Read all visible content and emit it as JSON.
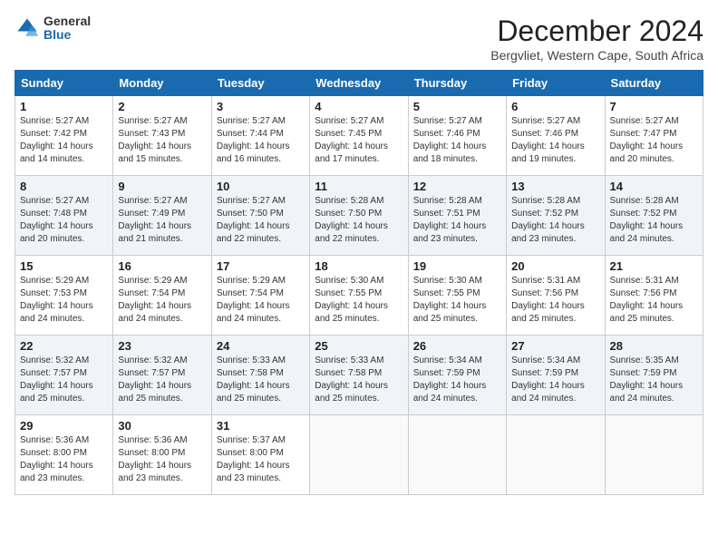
{
  "logo": {
    "general": "General",
    "blue": "Blue"
  },
  "title": "December 2024",
  "location": "Bergvliet, Western Cape, South Africa",
  "header_color": "#1a6ab0",
  "days_of_week": [
    "Sunday",
    "Monday",
    "Tuesday",
    "Wednesday",
    "Thursday",
    "Friday",
    "Saturday"
  ],
  "weeks": [
    [
      {
        "day": "1",
        "sunrise": "5:27 AM",
        "sunset": "7:42 PM",
        "daylight": "14 hours and 14 minutes."
      },
      {
        "day": "2",
        "sunrise": "5:27 AM",
        "sunset": "7:43 PM",
        "daylight": "14 hours and 15 minutes."
      },
      {
        "day": "3",
        "sunrise": "5:27 AM",
        "sunset": "7:44 PM",
        "daylight": "14 hours and 16 minutes."
      },
      {
        "day": "4",
        "sunrise": "5:27 AM",
        "sunset": "7:45 PM",
        "daylight": "14 hours and 17 minutes."
      },
      {
        "day": "5",
        "sunrise": "5:27 AM",
        "sunset": "7:46 PM",
        "daylight": "14 hours and 18 minutes."
      },
      {
        "day": "6",
        "sunrise": "5:27 AM",
        "sunset": "7:46 PM",
        "daylight": "14 hours and 19 minutes."
      },
      {
        "day": "7",
        "sunrise": "5:27 AM",
        "sunset": "7:47 PM",
        "daylight": "14 hours and 20 minutes."
      }
    ],
    [
      {
        "day": "8",
        "sunrise": "5:27 AM",
        "sunset": "7:48 PM",
        "daylight": "14 hours and 20 minutes."
      },
      {
        "day": "9",
        "sunrise": "5:27 AM",
        "sunset": "7:49 PM",
        "daylight": "14 hours and 21 minutes."
      },
      {
        "day": "10",
        "sunrise": "5:27 AM",
        "sunset": "7:50 PM",
        "daylight": "14 hours and 22 minutes."
      },
      {
        "day": "11",
        "sunrise": "5:28 AM",
        "sunset": "7:50 PM",
        "daylight": "14 hours and 22 minutes."
      },
      {
        "day": "12",
        "sunrise": "5:28 AM",
        "sunset": "7:51 PM",
        "daylight": "14 hours and 23 minutes."
      },
      {
        "day": "13",
        "sunrise": "5:28 AM",
        "sunset": "7:52 PM",
        "daylight": "14 hours and 23 minutes."
      },
      {
        "day": "14",
        "sunrise": "5:28 AM",
        "sunset": "7:52 PM",
        "daylight": "14 hours and 24 minutes."
      }
    ],
    [
      {
        "day": "15",
        "sunrise": "5:29 AM",
        "sunset": "7:53 PM",
        "daylight": "14 hours and 24 minutes."
      },
      {
        "day": "16",
        "sunrise": "5:29 AM",
        "sunset": "7:54 PM",
        "daylight": "14 hours and 24 minutes."
      },
      {
        "day": "17",
        "sunrise": "5:29 AM",
        "sunset": "7:54 PM",
        "daylight": "14 hours and 24 minutes."
      },
      {
        "day": "18",
        "sunrise": "5:30 AM",
        "sunset": "7:55 PM",
        "daylight": "14 hours and 25 minutes."
      },
      {
        "day": "19",
        "sunrise": "5:30 AM",
        "sunset": "7:55 PM",
        "daylight": "14 hours and 25 minutes."
      },
      {
        "day": "20",
        "sunrise": "5:31 AM",
        "sunset": "7:56 PM",
        "daylight": "14 hours and 25 minutes."
      },
      {
        "day": "21",
        "sunrise": "5:31 AM",
        "sunset": "7:56 PM",
        "daylight": "14 hours and 25 minutes."
      }
    ],
    [
      {
        "day": "22",
        "sunrise": "5:32 AM",
        "sunset": "7:57 PM",
        "daylight": "14 hours and 25 minutes."
      },
      {
        "day": "23",
        "sunrise": "5:32 AM",
        "sunset": "7:57 PM",
        "daylight": "14 hours and 25 minutes."
      },
      {
        "day": "24",
        "sunrise": "5:33 AM",
        "sunset": "7:58 PM",
        "daylight": "14 hours and 25 minutes."
      },
      {
        "day": "25",
        "sunrise": "5:33 AM",
        "sunset": "7:58 PM",
        "daylight": "14 hours and 25 minutes."
      },
      {
        "day": "26",
        "sunrise": "5:34 AM",
        "sunset": "7:59 PM",
        "daylight": "14 hours and 24 minutes."
      },
      {
        "day": "27",
        "sunrise": "5:34 AM",
        "sunset": "7:59 PM",
        "daylight": "14 hours and 24 minutes."
      },
      {
        "day": "28",
        "sunrise": "5:35 AM",
        "sunset": "7:59 PM",
        "daylight": "14 hours and 24 minutes."
      }
    ],
    [
      {
        "day": "29",
        "sunrise": "5:36 AM",
        "sunset": "8:00 PM",
        "daylight": "14 hours and 23 minutes."
      },
      {
        "day": "30",
        "sunrise": "5:36 AM",
        "sunset": "8:00 PM",
        "daylight": "14 hours and 23 minutes."
      },
      {
        "day": "31",
        "sunrise": "5:37 AM",
        "sunset": "8:00 PM",
        "daylight": "14 hours and 23 minutes."
      },
      null,
      null,
      null,
      null
    ]
  ],
  "labels": {
    "sunrise": "Sunrise:",
    "sunset": "Sunset:",
    "daylight": "Daylight hours"
  }
}
